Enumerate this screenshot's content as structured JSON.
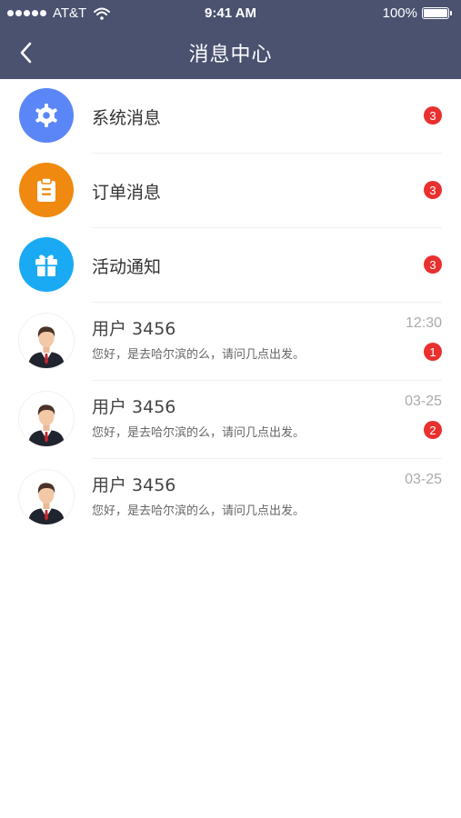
{
  "status_bar": {
    "carrier": "AT&T",
    "time": "9:41 AM",
    "battery": "100%",
    "battery_level": 1.0
  },
  "nav": {
    "title": "消息中心",
    "back_icon": "chevron-left-icon"
  },
  "categories": [
    {
      "label": "系统消息",
      "badge": "3",
      "icon": "gear-icon",
      "color": "#5b86f7"
    },
    {
      "label": "订单消息",
      "badge": "3",
      "icon": "clipboard-icon",
      "color": "#f0890f"
    },
    {
      "label": "活动通知",
      "badge": "3",
      "icon": "gift-icon",
      "color": "#1aaaf3"
    }
  ],
  "chats": [
    {
      "name": "用户 3456",
      "preview": "您好，是去哈尔滨的么，请问几点出发。",
      "time": "12:30",
      "badge": "1"
    },
    {
      "name": "用户 3456",
      "preview": "您好，是去哈尔滨的么，请问几点出发。",
      "time": "03-25",
      "badge": "2"
    },
    {
      "name": "用户 3456",
      "preview": "您好，是去哈尔滨的么，请问几点出发。",
      "time": "03-25",
      "badge": ""
    }
  ],
  "colors": {
    "header_bg": "#4a5270",
    "badge_red": "#e8302f"
  }
}
